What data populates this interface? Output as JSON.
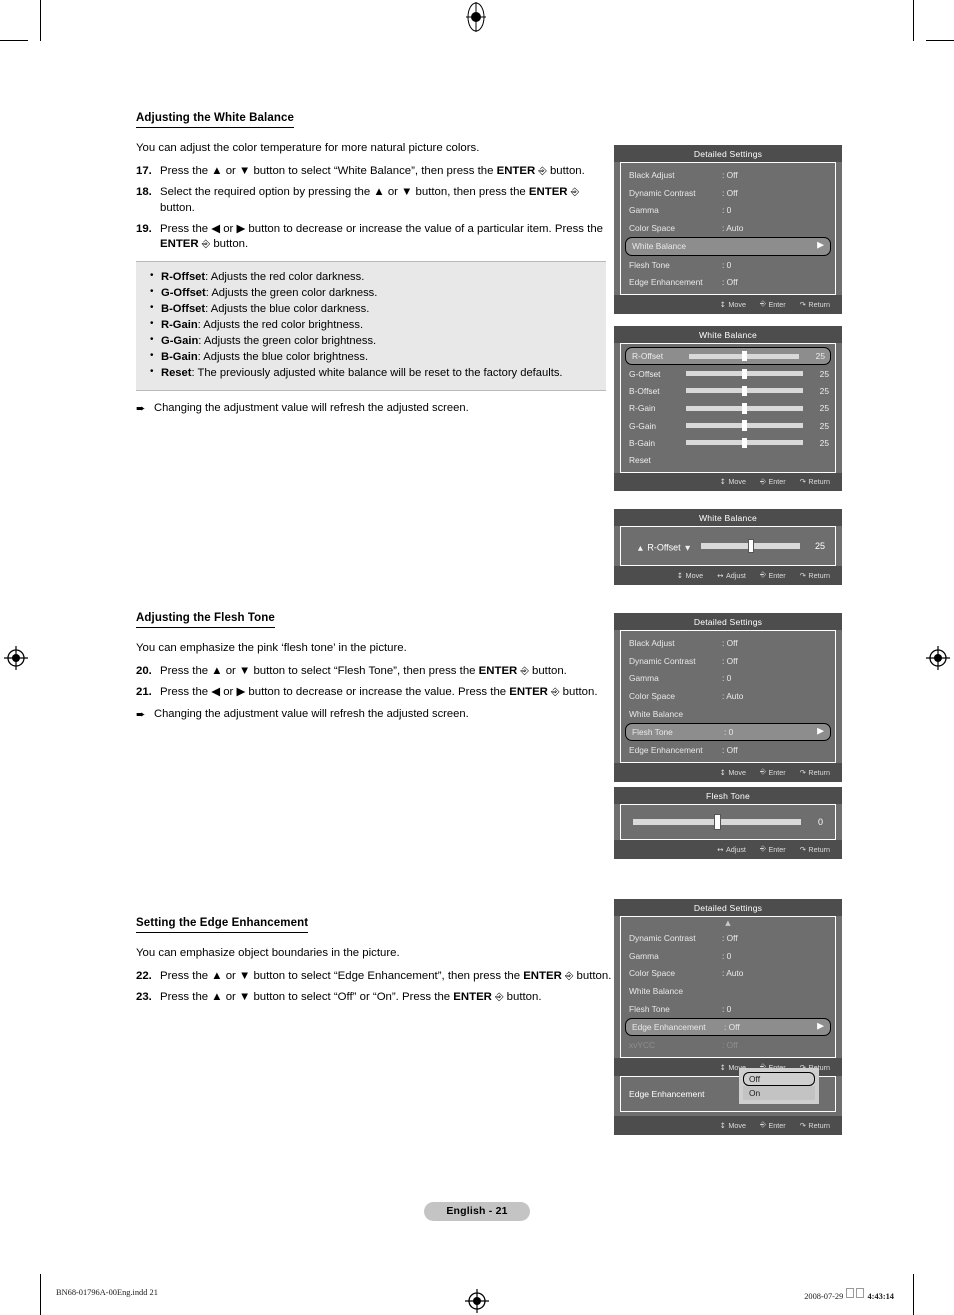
{
  "document": {
    "page_badge": "English - 21",
    "footer_left": "BN68-01796A-00Eng.indd   21",
    "footer_right_date": "2008-07-29",
    "footer_right_time": "4:43:14"
  },
  "sections": [
    {
      "heading": "Adjusting the White Balance",
      "intro": "You can adjust the color temperature for more natural picture colors.",
      "steps": [
        {
          "num": "17.",
          "text_parts": [
            "Press the ▲ or ▼ button to select “White Balance”, then press the ",
            "ENTER",
            " button."
          ]
        },
        {
          "num": "18.",
          "text_parts": [
            "Select the required option by pressing the ▲ or ▼ button, then press the ",
            "ENTER",
            " button."
          ]
        },
        {
          "num": "19.",
          "text_parts": [
            "Press the ◀ or ▶ button to decrease or increase the value of a particular item. Press the ",
            "ENTER",
            " button."
          ]
        }
      ],
      "bullets": [
        {
          "term": "R-Offset",
          "desc": ": Adjusts the red color darkness."
        },
        {
          "term": "G-Offset",
          "desc": ": Adjusts the green color darkness."
        },
        {
          "term": "B-Offset",
          "desc": ": Adjusts the blue color darkness."
        },
        {
          "term": "R-Gain",
          "desc": ": Adjusts the red color brightness."
        },
        {
          "term": "G-Gain",
          "desc": ": Adjusts the green color brightness."
        },
        {
          "term": "B-Gain",
          "desc": ": Adjusts the blue color brightness."
        },
        {
          "term": "Reset",
          "desc": ": The previously adjusted white balance will be reset to the factory defaults."
        }
      ],
      "note": "Changing the adjustment value will refresh the adjusted screen."
    },
    {
      "heading": "Adjusting the Flesh Tone",
      "intro": "You can emphasize the pink ‘flesh tone’ in the picture.",
      "steps": [
        {
          "num": "20.",
          "text_parts": [
            "Press the ▲ or ▼ button to select “Flesh Tone”, then press the ",
            "ENTER",
            " button."
          ]
        },
        {
          "num": "21.",
          "text_parts": [
            "Press the ◀ or ▶ button to decrease or increase the value. Press the ",
            "ENTER",
            " button."
          ]
        }
      ],
      "note": "Changing the adjustment value will refresh the adjusted screen."
    },
    {
      "heading": "Setting the Edge Enhancement",
      "intro": "You can emphasize object boundaries in the picture.",
      "steps": [
        {
          "num": "22.",
          "text_parts": [
            "Press the ▲ or ▼ button to select “Edge Enhancement”, then press the ",
            "ENTER",
            " button."
          ]
        },
        {
          "num": "23.",
          "text_parts": [
            "Press the ▲ or ▼ button to select “Off” or “On”. Press the ",
            "ENTER",
            " button."
          ]
        }
      ]
    }
  ],
  "hints": {
    "move": "Move",
    "adjust": "Adjust",
    "enter": "Enter",
    "return": "Return"
  },
  "osd": {
    "detailed_settings_1": {
      "title": "Detailed Settings",
      "rows": [
        {
          "label": "Black Adjust",
          "value": ": Off"
        },
        {
          "label": "Dynamic Contrast",
          "value": ": Off"
        },
        {
          "label": "Gamma",
          "value": ": 0"
        },
        {
          "label": "Color Space",
          "value": ": Auto"
        },
        {
          "label": "White Balance",
          "value": ""
        },
        {
          "label": "Flesh Tone",
          "value": ": 0"
        },
        {
          "label": "Edge Enhancement",
          "value": ": Off"
        }
      ],
      "selected_index": 4
    },
    "white_balance_list": {
      "title": "White Balance",
      "rows": [
        {
          "label": "R-Offset",
          "value": "25",
          "percent": 50
        },
        {
          "label": "G-Offset",
          "value": "25",
          "percent": 50
        },
        {
          "label": "B-Offset",
          "value": "25",
          "percent": 50
        },
        {
          "label": "R-Gain",
          "value": "25",
          "percent": 50
        },
        {
          "label": "G-Gain",
          "value": "25",
          "percent": 50
        },
        {
          "label": "B-Gain",
          "value": "25",
          "percent": 50
        },
        {
          "label": "Reset",
          "value": "",
          "percent": null
        }
      ],
      "selected_index": 0
    },
    "white_balance_adjust": {
      "title": "White Balance",
      "item_label": "R-Offset",
      "value": "25",
      "percent": 50
    },
    "detailed_settings_2": {
      "title": "Detailed Settings",
      "rows": [
        {
          "label": "Black Adjust",
          "value": ": Off"
        },
        {
          "label": "Dynamic Contrast",
          "value": ": Off"
        },
        {
          "label": "Gamma",
          "value": ": 0"
        },
        {
          "label": "Color Space",
          "value": ": Auto"
        },
        {
          "label": "White Balance",
          "value": ""
        },
        {
          "label": "Flesh Tone",
          "value": ": 0"
        },
        {
          "label": "Edge Enhancement",
          "value": ": Off"
        }
      ],
      "selected_index": 5
    },
    "flesh_tone_adjust": {
      "title": "Flesh Tone",
      "value": "0",
      "percent": 50
    },
    "detailed_settings_3": {
      "title": "Detailed Settings",
      "rows": [
        {
          "label": "Dynamic Contrast",
          "value": ": Off"
        },
        {
          "label": "Gamma",
          "value": ": 0"
        },
        {
          "label": "Color Space",
          "value": ": Auto"
        },
        {
          "label": "White Balance",
          "value": ""
        },
        {
          "label": "Flesh Tone",
          "value": ": 0"
        },
        {
          "label": "Edge Enhancement",
          "value": ": Off"
        },
        {
          "label": "xvYCC",
          "value": ": Off"
        }
      ],
      "selected_index": 5,
      "dim_index": 6,
      "scroll_up": true
    },
    "edge_enhancement_dropdown": {
      "label": "Edge Enhancement",
      "colon": ":",
      "options": [
        "Off",
        "On"
      ],
      "selected_option": "Off"
    }
  }
}
